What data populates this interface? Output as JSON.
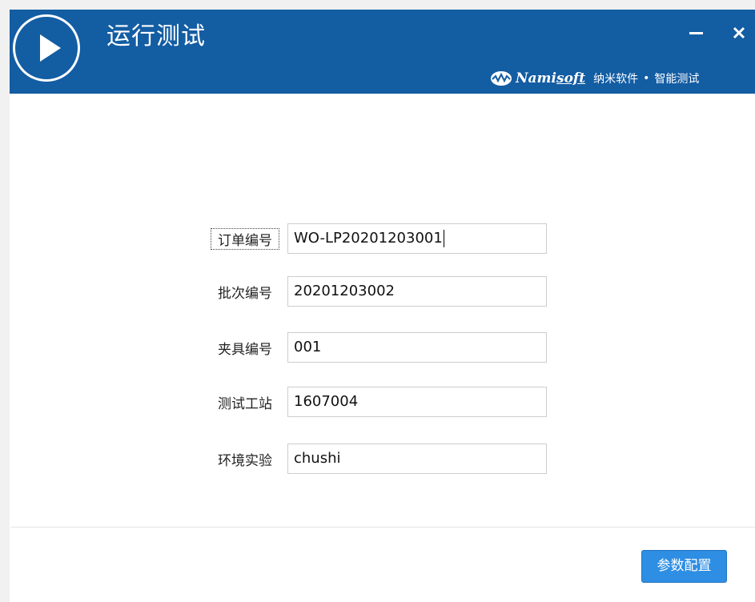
{
  "header": {
    "title": "运行测试",
    "icon": "play-icon",
    "minimize_icon": "minimize-icon",
    "close_icon": "close-icon",
    "brand": {
      "logo_icon": "namisoft-logo-icon",
      "name_prefix": "Nami",
      "name_suffix": "soft",
      "chinese_name": "纳米软件",
      "separator": "•",
      "slogan": "智能测试"
    }
  },
  "form": {
    "fields": [
      {
        "label": "订单编号",
        "value": "WO-LP20201203001"
      },
      {
        "label": "批次编号",
        "value": "20201203002"
      },
      {
        "label": "夹具编号",
        "value": "001"
      },
      {
        "label": "测试工站",
        "value": "1607004"
      },
      {
        "label": "环境实验",
        "value": "chushi"
      }
    ]
  },
  "footer": {
    "config_button_label": "参数配置"
  },
  "colors": {
    "header_bg": "#135da3",
    "button_bg": "#2d8ee3",
    "window_bg": "#ffffff"
  }
}
